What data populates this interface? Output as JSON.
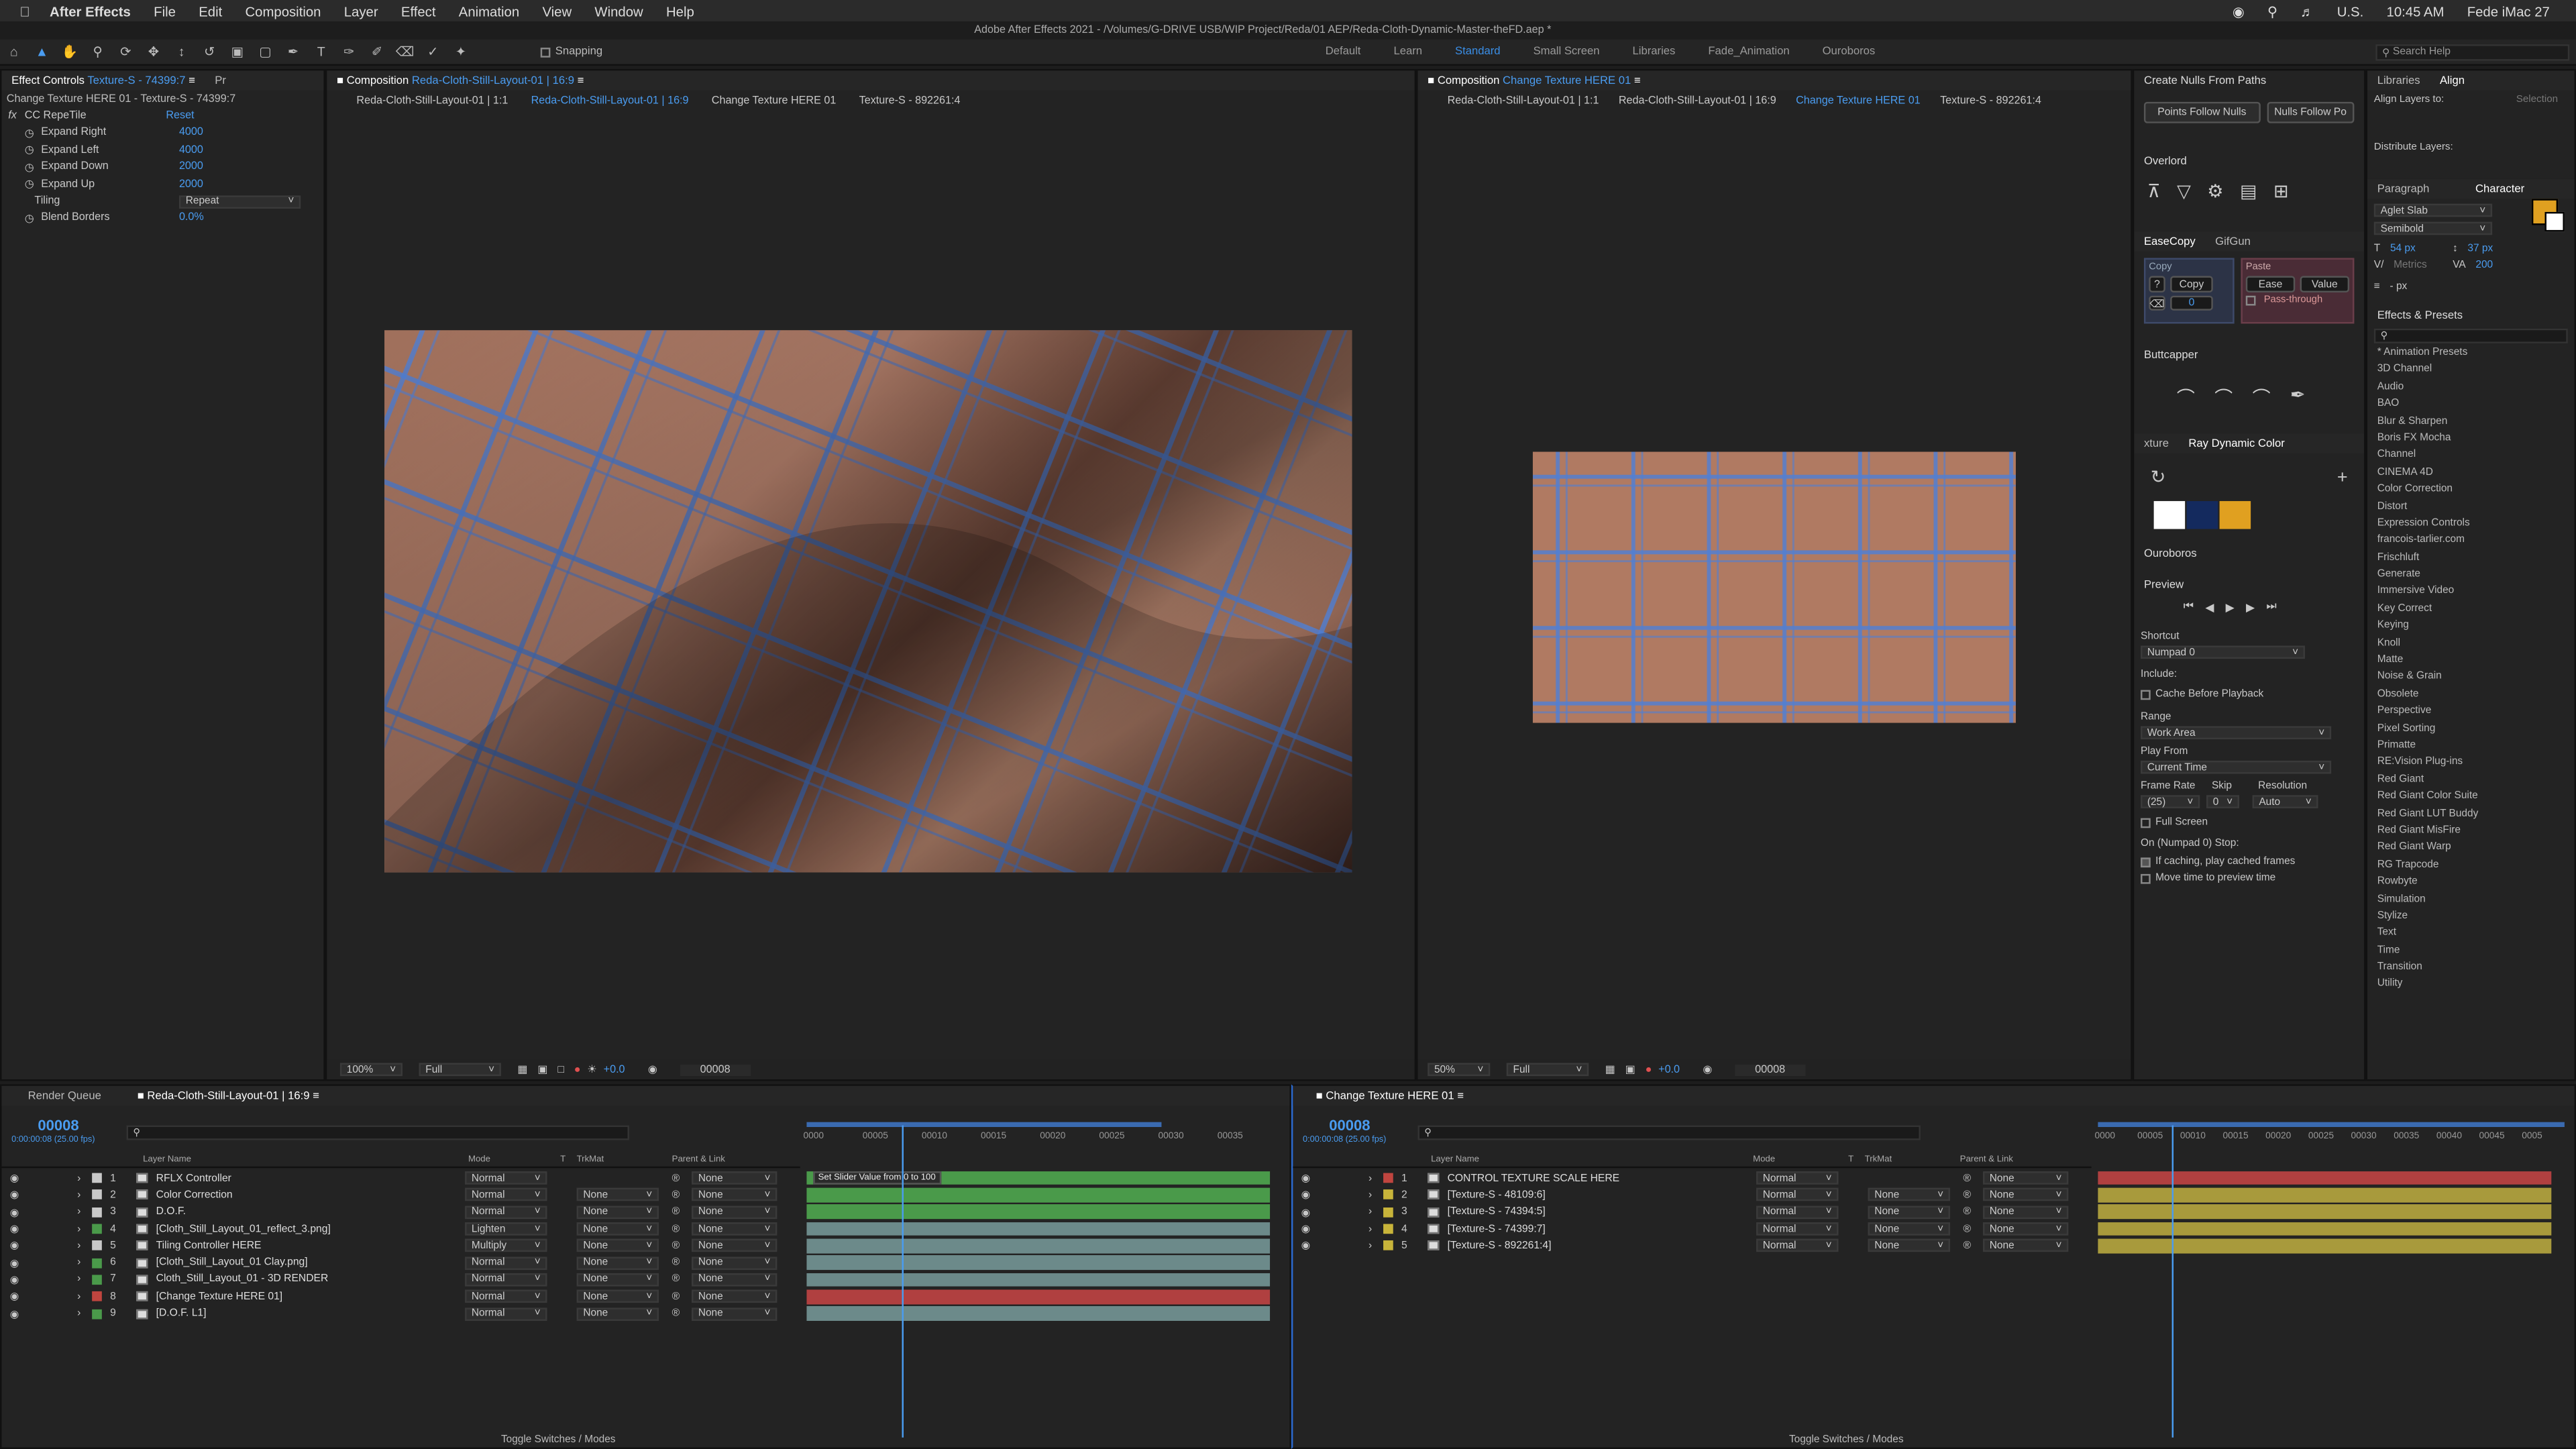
{
  "menubar": {
    "app": "After Effects",
    "items": [
      "File",
      "Edit",
      "Composition",
      "Layer",
      "Effect",
      "Animation",
      "View",
      "Window",
      "Help"
    ],
    "locale": "U.S.",
    "time": "10:45 AM",
    "user": "Fede iMac 27"
  },
  "title": "Adobe After Effects 2021 - /Volumes/G-DRIVE USB/WIP Project/Reda/01 AEP/Reda-Cloth-Dynamic-Master-theFD.aep *",
  "toolbar": {
    "snapping": "Snapping",
    "workspaces": [
      "Default",
      "Learn",
      "Standard",
      "Small Screen",
      "Libraries",
      "Fade_Animation",
      "Ouroboros"
    ],
    "search": "Search Help"
  },
  "effect_controls": {
    "tab": "Effect Controls",
    "tab_layer": "Texture-S - 74399:7",
    "tab2": "Pr",
    "path": "Change Texture HERE 01 - Texture-S - 74399:7",
    "fx_name": "CC RepeTile",
    "reset": "Reset",
    "props": [
      {
        "name": "Expand Right",
        "value": "4000"
      },
      {
        "name": "Expand Left",
        "value": "4000"
      },
      {
        "name": "Expand Down",
        "value": "2000"
      },
      {
        "name": "Expand Up",
        "value": "2000"
      }
    ],
    "tiling_label": "Tiling",
    "tiling_value": "Repeat",
    "blend_label": "Blend Borders",
    "blend_value": "0.0%"
  },
  "comp1": {
    "tab": "Composition",
    "name": "Reda-Cloth-Still-Layout-01 | 16:9",
    "crumbs": [
      "Reda-Cloth-Still-Layout-01 | 1:1",
      "Reda-Cloth-Still-Layout-01 | 16:9",
      "Change Texture HERE 01",
      "Texture-S - 892261:4"
    ],
    "zoom": "100%",
    "res": "Full",
    "exposure": "+0.0",
    "timecode": "00008"
  },
  "comp2": {
    "tab": "Composition",
    "name": "Change Texture HERE 01",
    "crumbs": [
      "Reda-Cloth-Still-Layout-01 | 1:1",
      "Reda-Cloth-Still-Layout-01 | 16:9",
      "Change Texture HERE 01",
      "Texture-S - 892261:4"
    ],
    "zoom": "50%",
    "res": "Full",
    "exposure": "+0.0",
    "timecode": "00008"
  },
  "right_panels": {
    "nulls_title": "Create Nulls From Paths",
    "nulls_btn1": "Points Follow Nulls",
    "nulls_btn2": "Nulls Follow Po",
    "overlord": "Overlord",
    "easecopy_tab": "EaseCopy",
    "gifgun_tab": "GifGun",
    "copy_label": "Copy",
    "copy_btn": "Copy",
    "copy_q": "?",
    "copy_num": "0",
    "paste_label": "Paste",
    "ease_btn": "Ease",
    "value_btn": "Value",
    "passthrough": "Pass-through",
    "buttcapper": "Buttcapper",
    "rdc_left": "xture",
    "rdc_tab": "Ray Dynamic Color",
    "ouroboros": "Ouroboros",
    "preview": {
      "title": "Preview",
      "shortcut_label": "Shortcut",
      "shortcut": "Numpad 0",
      "include": "Include:",
      "cache": "Cache Before Playback",
      "range_label": "Range",
      "range": "Work Area",
      "playfrom_label": "Play From",
      "playfrom": "Current Time",
      "fr_label": "Frame Rate",
      "skip_label": "Skip",
      "res_label": "Resolution",
      "fr": "(25)",
      "skip": "0",
      "res": "Auto",
      "fullscreen": "Full Screen",
      "stop_label": "On (Numpad 0) Stop:",
      "cached": "If caching, play cached frames",
      "movetime": "Move time to preview time"
    }
  },
  "far_right": {
    "libraries": "Libraries",
    "align": "Align",
    "align_to": "Align Layers to:",
    "selection": "Selection",
    "distribute": "Distribute Layers:",
    "paragraph": "Paragraph",
    "character": "Character",
    "font": "Aglet Slab",
    "style": "Semibold",
    "size": "54 px",
    "leading": "37 px",
    "metrics": "Metrics",
    "tracking": "200",
    "unit": "- px",
    "effects_title": "Effects & Presets",
    "effects": [
      "* Animation Presets",
      "3D Channel",
      "Audio",
      "BAO",
      "Blur & Sharpen",
      "Boris FX Mocha",
      "Channel",
      "CINEMA 4D",
      "Color Correction",
      "Distort",
      "Expression Controls",
      "francois-tarlier.com",
      "Frischluft",
      "Generate",
      "Immersive Video",
      "Key Correct",
      "Keying",
      "Knoll",
      "Matte",
      "Noise & Grain",
      "Obsolete",
      "Perspective",
      "Pixel Sorting",
      "Primatte",
      "RE:Vision Plug-ins",
      "Red Giant",
      "Red Giant Color Suite",
      "Red Giant LUT Buddy",
      "Red Giant MisFire",
      "Red Giant Warp",
      "RG Trapcode",
      "Rowbyte",
      "Simulation",
      "Stylize",
      "Text",
      "Time",
      "Transition",
      "Utility"
    ]
  },
  "timeline1": {
    "render_queue": "Render Queue",
    "tab": "Reda-Cloth-Still-Layout-01 | 16:9",
    "timecode": "00008",
    "fps": "0:00:00:08 (25.00 fps)",
    "col_name": "Layer Name",
    "col_mode": "Mode",
    "col_t": "T",
    "col_trk": "TrkMat",
    "col_parent": "Parent & Link",
    "ticks": [
      "0000",
      "00005",
      "00010",
      "00015",
      "00020",
      "00025",
      "00030",
      "00035"
    ],
    "tooltip": "Set Slider Value from 0 to 100",
    "toggle": "Toggle Switches / Modes",
    "layers": [
      {
        "n": "1",
        "name": "RFLX Controller",
        "mode": "Normal",
        "trk": "",
        "parent": "None",
        "color": "#c8c8c8",
        "bar": "#4a9a4a"
      },
      {
        "n": "2",
        "name": "Color Correction",
        "mode": "Normal",
        "trk": "None",
        "parent": "None",
        "color": "#c8c8c8",
        "bar": "#4a9a4a"
      },
      {
        "n": "3",
        "name": "D.O.F.",
        "mode": "Normal",
        "trk": "None",
        "parent": "None",
        "color": "#c8c8c8",
        "bar": "#4a9a4a"
      },
      {
        "n": "4",
        "name": "[Cloth_Still_Layout_01_reflect_3.png]",
        "mode": "Lighten",
        "trk": "None",
        "parent": "None",
        "color": "#4a9a4a",
        "bar": "#6c8a8a"
      },
      {
        "n": "5",
        "name": "Tiling Controller HERE",
        "mode": "Multiply",
        "trk": "None",
        "parent": "None",
        "color": "#c8c8c8",
        "bar": "#6c8a8a"
      },
      {
        "n": "6",
        "name": "[Cloth_Still_Layout_01 Clay.png]",
        "mode": "Normal",
        "trk": "None",
        "parent": "None",
        "color": "#4a9a4a",
        "bar": "#6c8a8a"
      },
      {
        "n": "7",
        "name": "Cloth_Still_Layout_01 - 3D RENDER",
        "mode": "Normal",
        "trk": "None",
        "parent": "None",
        "color": "#4a9a4a",
        "bar": "#6c8a8a"
      },
      {
        "n": "8",
        "name": "[Change Texture HERE 01]",
        "mode": "Normal",
        "trk": "None",
        "parent": "None",
        "color": "#c0453f",
        "bar": "#b04040"
      },
      {
        "n": "9",
        "name": "[D.O.F. L1]",
        "mode": "Normal",
        "trk": "None",
        "parent": "None",
        "color": "#4a9a4a",
        "bar": "#6c8a8a"
      }
    ]
  },
  "timeline2": {
    "tab": "Change Texture HERE 01",
    "timecode": "00008",
    "fps": "0:00:00:08 (25.00 fps)",
    "col_name": "Layer Name",
    "col_mode": "Mode",
    "col_t": "T",
    "col_trk": "TrkMat",
    "col_parent": "Parent & Link",
    "ticks": [
      "0000",
      "00005",
      "00010",
      "00015",
      "00020",
      "00025",
      "00030",
      "00035",
      "00040",
      "00045",
      "0005"
    ],
    "toggle": "Toggle Switches / Modes",
    "layers": [
      {
        "n": "1",
        "name": "CONTROL TEXTURE SCALE HERE",
        "mode": "Normal",
        "trk": "",
        "parent": "None",
        "color": "#c0453f",
        "bar": "#b04040"
      },
      {
        "n": "2",
        "name": "[Texture-S - 48109:6]",
        "mode": "Normal",
        "trk": "None",
        "parent": "None",
        "color": "#c8b43a",
        "bar": "#a89a3c"
      },
      {
        "n": "3",
        "name": "[Texture-S - 74394:5]",
        "mode": "Normal",
        "trk": "None",
        "parent": "None",
        "color": "#c8b43a",
        "bar": "#a89a3c"
      },
      {
        "n": "4",
        "name": "[Texture-S - 74399:7]",
        "mode": "Normal",
        "trk": "None",
        "parent": "None",
        "color": "#c8b43a",
        "bar": "#a89a3c"
      },
      {
        "n": "5",
        "name": "[Texture-S - 892261:4]",
        "mode": "Normal",
        "trk": "None",
        "parent": "None",
        "color": "#c8b43a",
        "bar": "#a89a3c"
      }
    ]
  }
}
